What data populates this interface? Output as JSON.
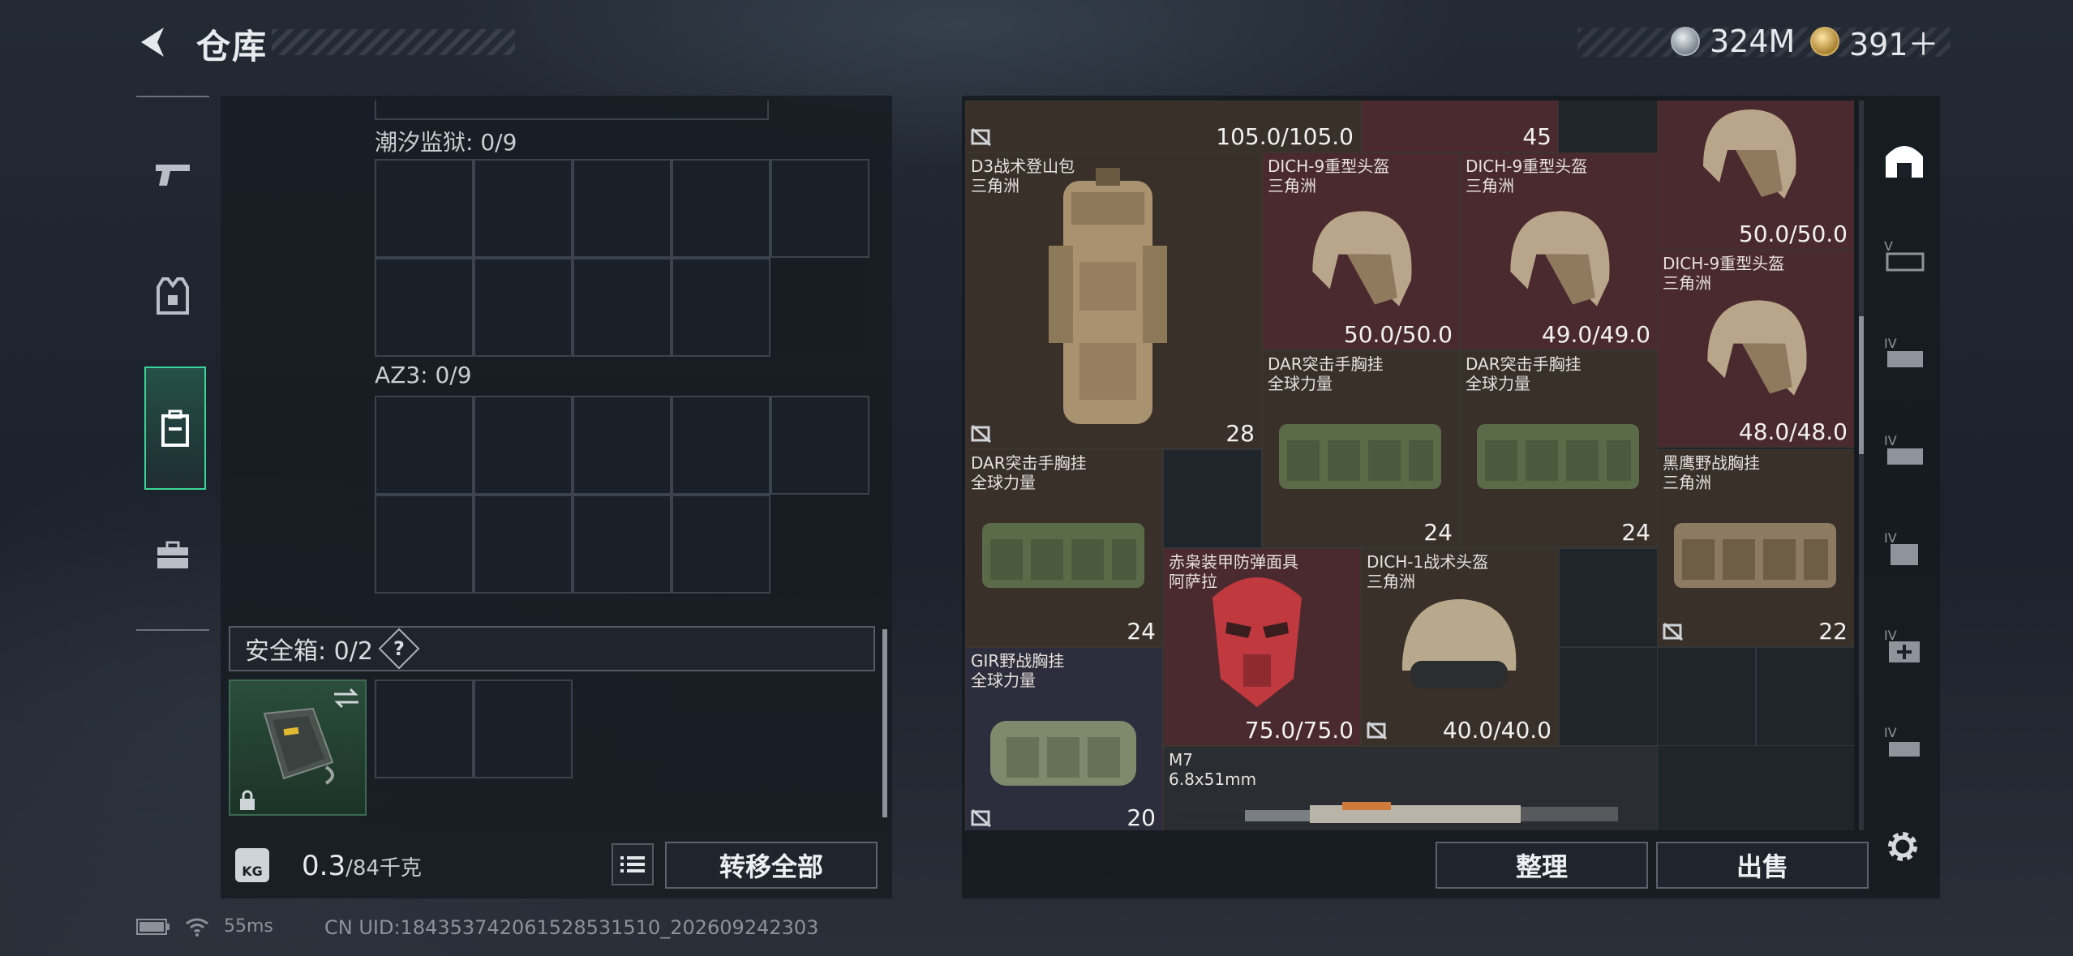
{
  "header": {
    "title": "仓库"
  },
  "currency": [
    {
      "name": "silver-coin",
      "value": "324M"
    },
    {
      "name": "gold-coin",
      "value": "391＋"
    }
  ],
  "left": {
    "section1": {
      "label": "潮汐监狱: 0/9"
    },
    "section2": {
      "label": "AZ3: 0/9"
    },
    "safebox": {
      "label": "安全箱: 0/2",
      "help": "?"
    },
    "weight": {
      "value": "0.3",
      "cap": "/84千克",
      "icon": "KG"
    },
    "transfer_all": "转移全部"
  },
  "items": [
    {
      "id": "top-left",
      "durability": "105.0/105.0"
    },
    {
      "id": "top-mid",
      "count": "45"
    },
    {
      "id": "helmet-top-right",
      "durability": "50.0/50.0"
    },
    {
      "id": "backpack-d3",
      "name": "D3战术登山包",
      "brand": "三角洲",
      "count": "28"
    },
    {
      "id": "helmet-1",
      "name": "DICH-9重型头盔",
      "brand": "三角洲",
      "durability": "50.0/50.0"
    },
    {
      "id": "helmet-2",
      "name": "DICH-9重型头盔",
      "brand": "三角洲",
      "durability": "49.0/49.0"
    },
    {
      "id": "helmet-3",
      "name": "DICH-9重型头盔",
      "brand": "三角洲",
      "durability": "48.0/48.0"
    },
    {
      "id": "rig-dar-1",
      "name": "DAR突击手胸挂",
      "brand": "全球力量",
      "count": "24"
    },
    {
      "id": "rig-dar-2",
      "name": "DAR突击手胸挂",
      "brand": "全球力量",
      "count": "24"
    },
    {
      "id": "rig-dar-3",
      "name": "DAR突击手胸挂",
      "brand": "全球力量",
      "count": "24"
    },
    {
      "id": "rig-blackhawk",
      "name": "黑鹰野战胸挂",
      "brand": "三角洲",
      "count": "22"
    },
    {
      "id": "mask",
      "name": "赤枭装甲防弹面具",
      "brand": "阿萨拉",
      "durability": "75.0/75.0"
    },
    {
      "id": "helmet-dich1",
      "name": "DICH-1战术头盔",
      "brand": "三角洲",
      "durability": "40.0/40.0"
    },
    {
      "id": "rig-gir",
      "name": "GIR野战胸挂",
      "brand": "全球力量",
      "count": "20"
    },
    {
      "id": "rifle-m7",
      "name": "M7",
      "brand": "6.8x51mm"
    }
  ],
  "right": {
    "sort": "整理",
    "sell": "出售"
  },
  "status": {
    "ping": "55ms",
    "uid": "CN UID:18435374206152853151​0_202609242303"
  }
}
